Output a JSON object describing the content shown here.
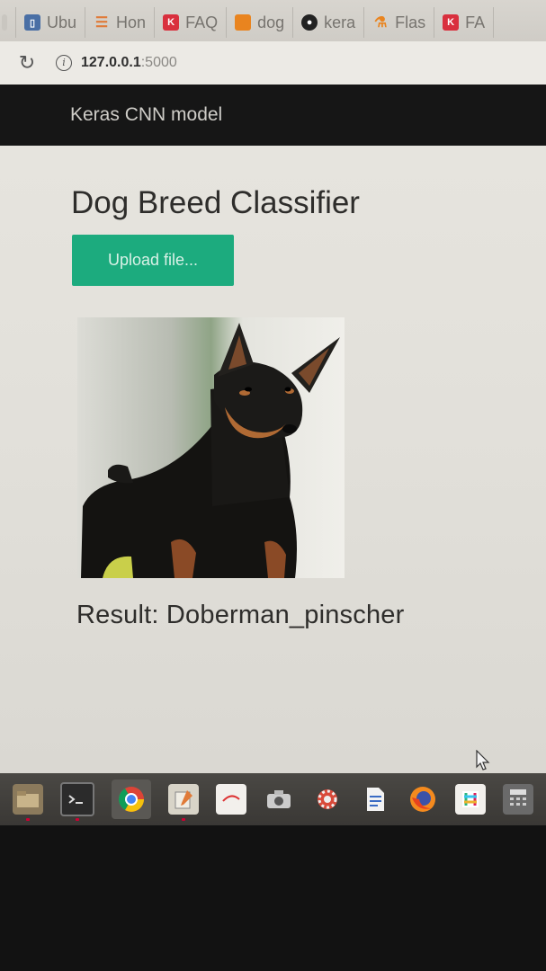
{
  "tabs": [
    {
      "label": "",
      "icon": "partial-tab-icon",
      "color": "#c9c6c0"
    },
    {
      "label": "Ubu",
      "icon": "bookmark-icon",
      "color": "#4a6fa5"
    },
    {
      "label": "Hon",
      "icon": "stackoverflow-icon",
      "color": "#e07b39"
    },
    {
      "label": "FAQ",
      "icon": "kaggle-k-icon",
      "color": "#d9303e"
    },
    {
      "label": "dog",
      "icon": "orange-page-icon",
      "color": "#e9841f"
    },
    {
      "label": "kera",
      "icon": "github-icon",
      "color": "#222222"
    },
    {
      "label": "Flas",
      "icon": "flask-icon",
      "color": "#e9841f"
    },
    {
      "label": "FA",
      "icon": "kaggle-k-icon",
      "color": "#d9303e"
    }
  ],
  "address": {
    "host": "127.0.0.1",
    "port": ":5000"
  },
  "navbar": {
    "brand": "Keras CNN model"
  },
  "page": {
    "title": "Dog Breed Classifier",
    "upload_label": "Upload file...",
    "result_text": "Result: Doberman_pinscher"
  },
  "taskbar": [
    {
      "icon": "files-icon",
      "active": false,
      "dot": true
    },
    {
      "icon": "terminal-icon",
      "active": false,
      "dot": true
    },
    {
      "icon": "chrome-icon",
      "active": true,
      "dot": false
    },
    {
      "icon": "text-editor-icon",
      "active": false,
      "dot": true
    },
    {
      "icon": "impress-icon",
      "active": false,
      "dot": false
    },
    {
      "icon": "camera-icon",
      "active": false,
      "dot": false
    },
    {
      "icon": "settings-icon",
      "active": false,
      "dot": false
    },
    {
      "icon": "writer-icon",
      "active": false,
      "dot": false
    },
    {
      "icon": "firefox-icon",
      "active": false,
      "dot": false
    },
    {
      "icon": "slack-icon",
      "active": false,
      "dot": false
    },
    {
      "icon": "calculator-icon",
      "active": false,
      "dot": false
    }
  ],
  "colors": {
    "navbar": "#161616",
    "button": "#1cab7e"
  }
}
